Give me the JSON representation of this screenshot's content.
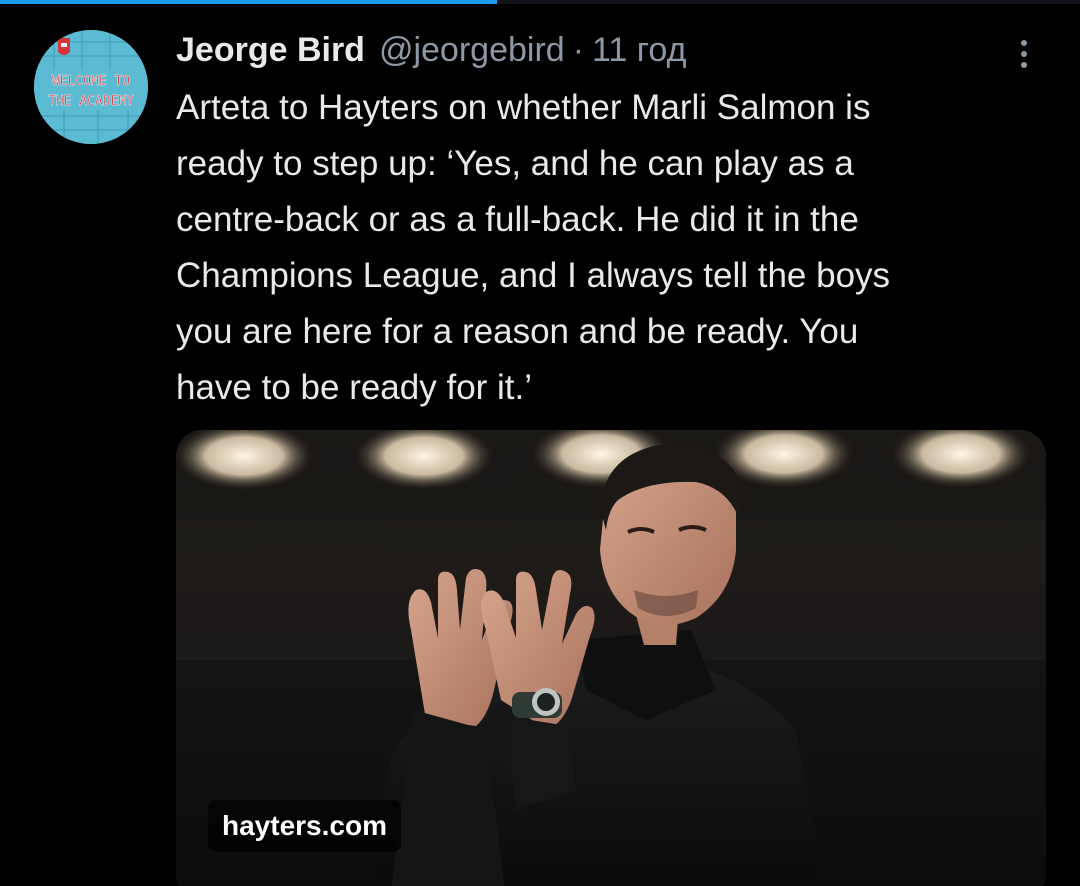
{
  "tweet": {
    "author_name": "Jeorge Bird",
    "author_handle": "@jeorgebird",
    "separator": "·",
    "timestamp": "11 год",
    "text": "Arteta to Hayters on whether Marli Salmon is\nready to step up: ‘Yes, and he can play as a\ncentre-back or as a full-back. He did it in the\nChampions League, and I always tell the boys\nyou are here for a reason and be ready. You\nhave to be ready for it.’",
    "avatar": {
      "lines": [
        "WELCOME TO",
        "THE ACADEMY"
      ]
    },
    "media": {
      "link_domain": "hayters.com"
    }
  },
  "icons": {
    "more": "more-vertical-icon"
  },
  "colors": {
    "background": "#000000",
    "text_primary": "#e7e9ea",
    "text_secondary": "#8b98a5",
    "accent": "#1d9bf0"
  },
  "progress": {
    "value": 0.46
  }
}
